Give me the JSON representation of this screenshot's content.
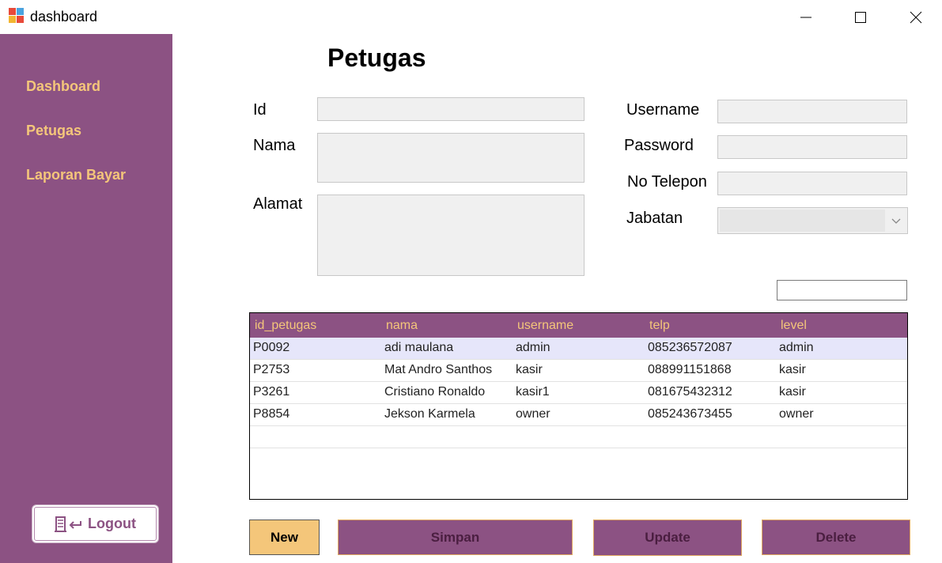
{
  "window": {
    "title": "dashboard",
    "controls": [
      "minimize",
      "maximize",
      "close"
    ]
  },
  "sidebar": {
    "items": [
      {
        "label": "Dashboard"
      },
      {
        "label": "Petugas"
      },
      {
        "label": "Laporan Bayar"
      }
    ],
    "logout_label": "Logout",
    "background": "#8c5283",
    "text_color": "#f4c67a"
  },
  "form": {
    "title": "Petugas",
    "labels": {
      "id": "Id",
      "nama": "Nama",
      "alamat": "Alamat",
      "username": "Username",
      "password": "Password",
      "no_telepon": "No Telepon",
      "jabatan": "Jabatan"
    },
    "values": {
      "id": "",
      "nama": "",
      "alamat": "",
      "username": "",
      "password": "",
      "no_telepon": "",
      "jabatan": "",
      "search": ""
    }
  },
  "grid": {
    "columns": [
      "id_petugas",
      "nama",
      "username",
      "telp",
      "level"
    ],
    "rows": [
      [
        "P0092",
        "adi maulana",
        "admin",
        "085236572087",
        "admin"
      ],
      [
        "P2753",
        "Mat Andro Santhos",
        "kasir",
        "088991151868",
        "kasir"
      ],
      [
        "P3261",
        "Cristiano Ronaldo",
        "kasir1",
        "081675432312",
        "kasir"
      ],
      [
        "P8854",
        "Jekson Karmela",
        "owner",
        "085243673455",
        "owner"
      ]
    ],
    "header_color": "#8c5283",
    "selected_row_color": "#e6e6fa"
  },
  "buttons": {
    "new": "New",
    "simpan": "Simpan",
    "update": "Update",
    "delete": "Delete"
  }
}
